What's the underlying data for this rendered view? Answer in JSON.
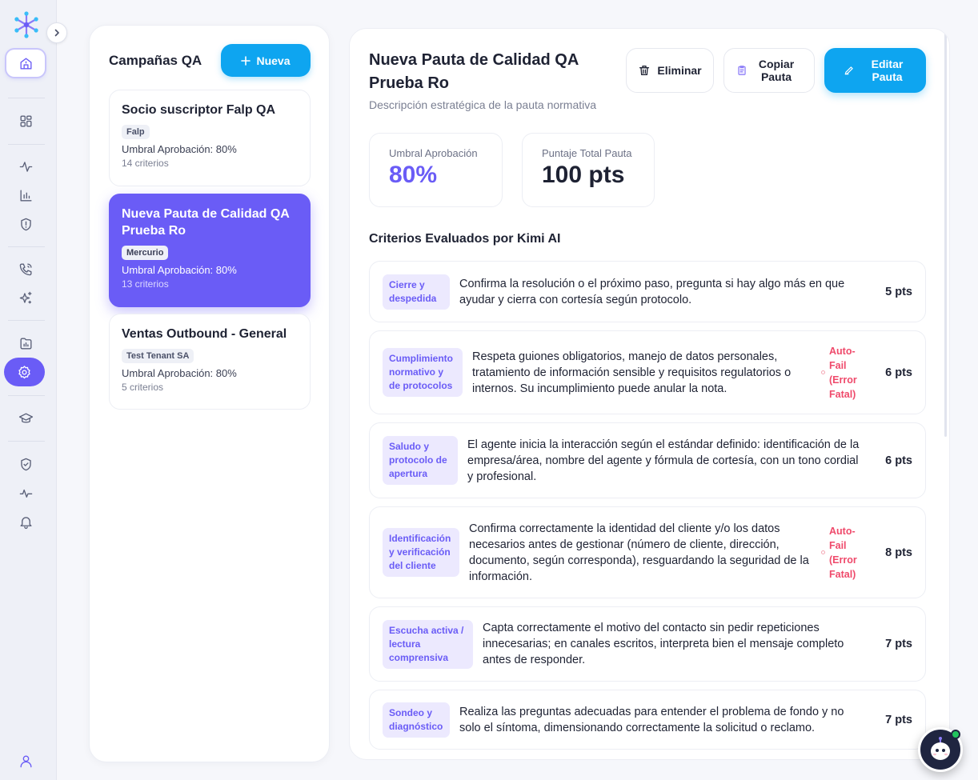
{
  "colors": {
    "accent": "#6a5cf6",
    "primary_button": "#0ea5f0",
    "autofail": "#ef4a6b"
  },
  "sidebar": {
    "icons": [
      "home-icon",
      "grid-icon",
      "activity-icon",
      "bar-chart-icon",
      "shield-alert-icon",
      "phone-call-icon",
      "sparkles-icon",
      "folder-chart-icon",
      "settings-icon",
      "graduation-cap-icon",
      "shield-check-icon",
      "pulse-icon",
      "bell-icon",
      "user-icon"
    ],
    "active": "settings-icon"
  },
  "campaigns": {
    "title": "Campañas QA",
    "new_label": "Nueva",
    "items": [
      {
        "name": "Socio suscriptor Falp QA",
        "tag": "Falp",
        "threshold": "Umbral Aprobación: 80%",
        "criteria": "14 criterios"
      },
      {
        "name": "Nueva Pauta de Calidad QA Prueba Ro",
        "tag": "Mercurio",
        "threshold": "Umbral Aprobación: 80%",
        "criteria": "13 criterios"
      },
      {
        "name": "Ventas Outbound - General",
        "tag": "Test Tenant SA",
        "threshold": "Umbral Aprobación: 80%",
        "criteria": "5 criterios"
      }
    ]
  },
  "detail": {
    "title": "Nueva Pauta de Calidad QA Prueba Ro",
    "description": "Descripción estratégica de la pauta normativa",
    "delete_label": "Eliminar",
    "copy_label": "Copiar Pauta",
    "edit_label": "Editar Pauta",
    "stats": {
      "threshold_label": "Umbral Aprobación",
      "threshold_value": "80%",
      "total_label": "Puntaje Total Pauta",
      "total_value": "100 pts"
    },
    "criteria_title": "Criterios Evaluados por Kimi AI",
    "criteria": [
      {
        "name": "Cierre y despedida",
        "desc": "Confirma la resolución o el próximo paso, pregunta si hay algo más en que ayudar y cierra con cortesía según protocolo.",
        "autofail": "",
        "pts": "5 pts"
      },
      {
        "name": "Cumplimiento normativo y de protocolos",
        "desc": "Respeta guiones obligatorios, manejo de datos personales, tratamiento de información sensible y requisitos regulatorios o internos. Su incumplimiento puede anular la nota.",
        "autofail": "Auto-Fail (Error Fatal)",
        "pts": "6 pts"
      },
      {
        "name": "Saludo y protocolo de apertura",
        "desc": "El agente inicia la interacción según el estándar definido: identificación de la empresa/área, nombre del agente y fórmula de cortesía, con un tono cordial y profesional.",
        "autofail": "",
        "pts": "6 pts"
      },
      {
        "name": "Identificación y verificación del cliente",
        "desc": "Confirma correctamente la identidad del cliente y/o los datos necesarios antes de gestionar (número de cliente, dirección, documento, según corresponda), resguardando la seguridad de la información.",
        "autofail": "Auto-Fail (Error Fatal)",
        "pts": "8 pts"
      },
      {
        "name": "Escucha activa / lectura comprensiva",
        "desc": "Capta correctamente el motivo del contacto sin pedir repeticiones innecesarias; en canales escritos, interpreta bien el mensaje completo antes de responder.",
        "autofail": "",
        "pts": "7 pts"
      },
      {
        "name": "Sondeo y diagnóstico",
        "desc": "Realiza las preguntas adecuadas para entender el problema de fondo y no solo el síntoma, dimensionando correctamente la solicitud o reclamo.",
        "autofail": "",
        "pts": "7 pts"
      }
    ]
  }
}
